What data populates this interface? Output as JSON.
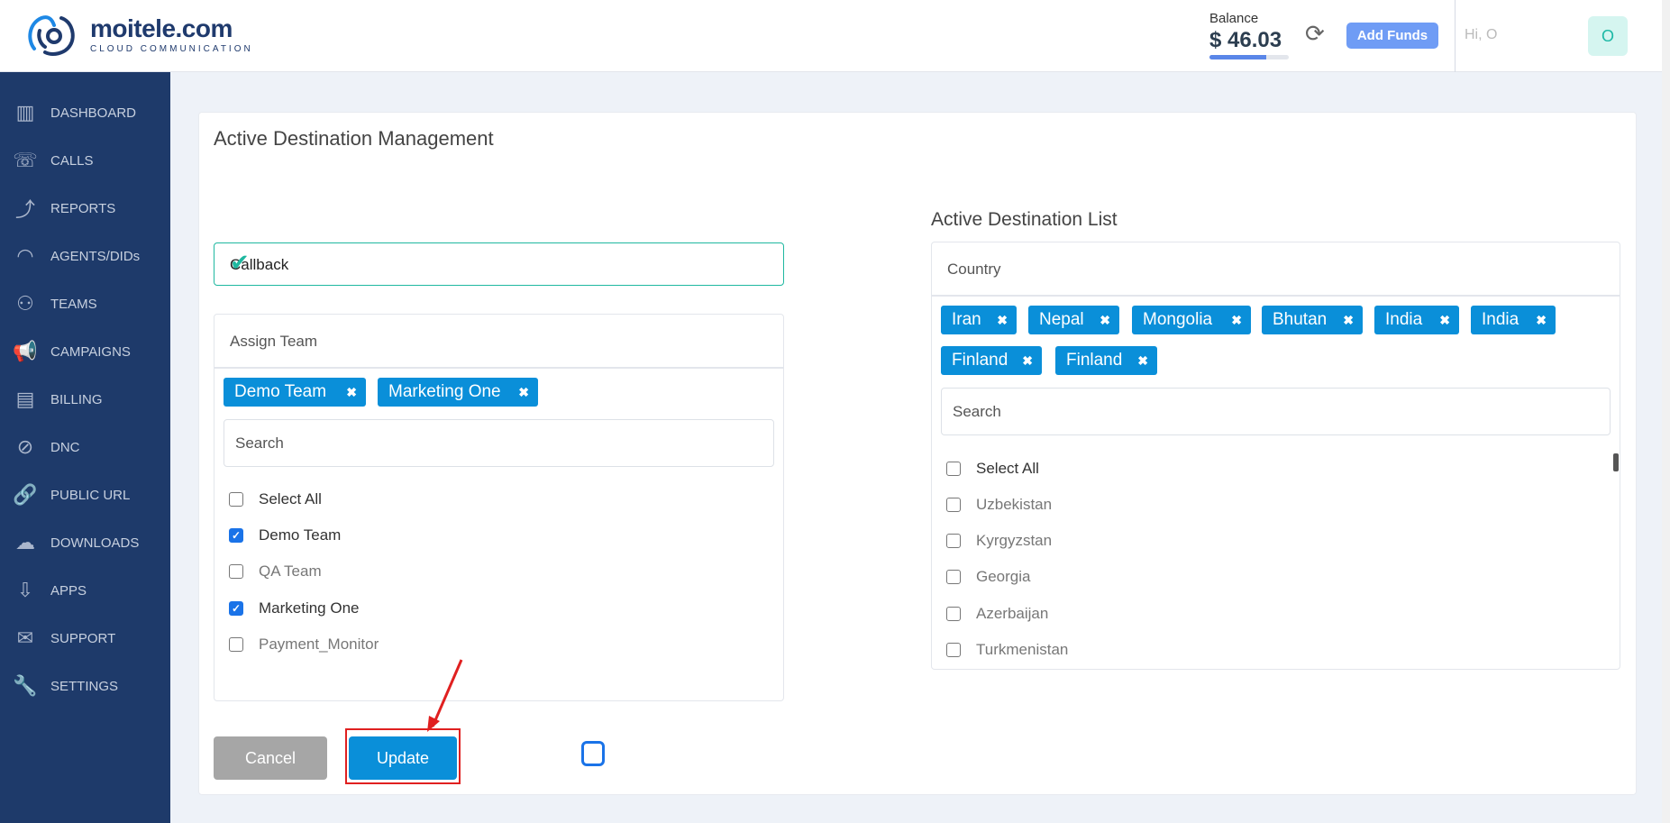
{
  "header": {
    "logo_name": "moitele.com",
    "logo_tagline": "CLOUD COMMUNICATION",
    "balance_label": "Balance",
    "balance_amount": "$ 46.03",
    "balance_progress": 0.72,
    "refresh_icon": "⟳",
    "add_funds_label": "Add Funds",
    "greeting": "Hi, O",
    "avatar_initial": "O"
  },
  "sidebar": {
    "items": [
      {
        "label": "DASHBOARD",
        "icon": "▥"
      },
      {
        "label": "CALLS",
        "icon": "☏"
      },
      {
        "label": "REPORTS",
        "icon": "⤴"
      },
      {
        "label": "AGENTS/DIDs",
        "icon": "◠"
      },
      {
        "label": "TEAMS",
        "icon": "⚇"
      },
      {
        "label": "CAMPAIGNS",
        "icon": "📢"
      },
      {
        "label": "BILLING",
        "icon": "▤"
      },
      {
        "label": "DNC",
        "icon": "⊘"
      },
      {
        "label": "PUBLIC URL",
        "icon": "🔗"
      },
      {
        "label": "DOWNLOADS",
        "icon": "☁"
      },
      {
        "label": "APPS",
        "icon": "⇩"
      },
      {
        "label": "SUPPORT",
        "icon": "✉"
      },
      {
        "label": "SETTINGS",
        "icon": "🔧"
      }
    ]
  },
  "main": {
    "title": "Active Destination Management",
    "callback_value": "Callback",
    "callback_check_icon": "✔",
    "assign_team_label": "Assign Team",
    "selected_teams": [
      "Demo Team",
      "Marketing One"
    ],
    "remove_icon": "✖",
    "team_search_placeholder": "Search",
    "team_options": [
      {
        "label": "Select All",
        "checked": false
      },
      {
        "label": "Demo Team",
        "checked": true
      },
      {
        "label": "QA Team",
        "checked": false
      },
      {
        "label": "Marketing One",
        "checked": true
      },
      {
        "label": "Payment_Monitor",
        "checked": false
      }
    ],
    "cancel_label": "Cancel",
    "update_label": "Update"
  },
  "destination": {
    "title": "Active Destination List",
    "country_label": "Country",
    "selected_countries": [
      "Iran",
      "Nepal",
      "Mongolia",
      "Bhutan",
      "India",
      "India",
      "Finland",
      "Finland"
    ],
    "search_placeholder": "Search",
    "options": [
      {
        "label": "Select All",
        "checked": false
      },
      {
        "label": "Uzbekistan",
        "checked": false
      },
      {
        "label": "Kyrgyzstan",
        "checked": false
      },
      {
        "label": "Georgia",
        "checked": false
      },
      {
        "label": "Azerbaijan",
        "checked": false
      },
      {
        "label": "Turkmenistan",
        "checked": false
      }
    ]
  },
  "colors": {
    "sidebar_bg": "#1e3a6a",
    "accent": "#0a8fd9",
    "success": "#1fb8a0",
    "annotation_red": "#e02020"
  }
}
